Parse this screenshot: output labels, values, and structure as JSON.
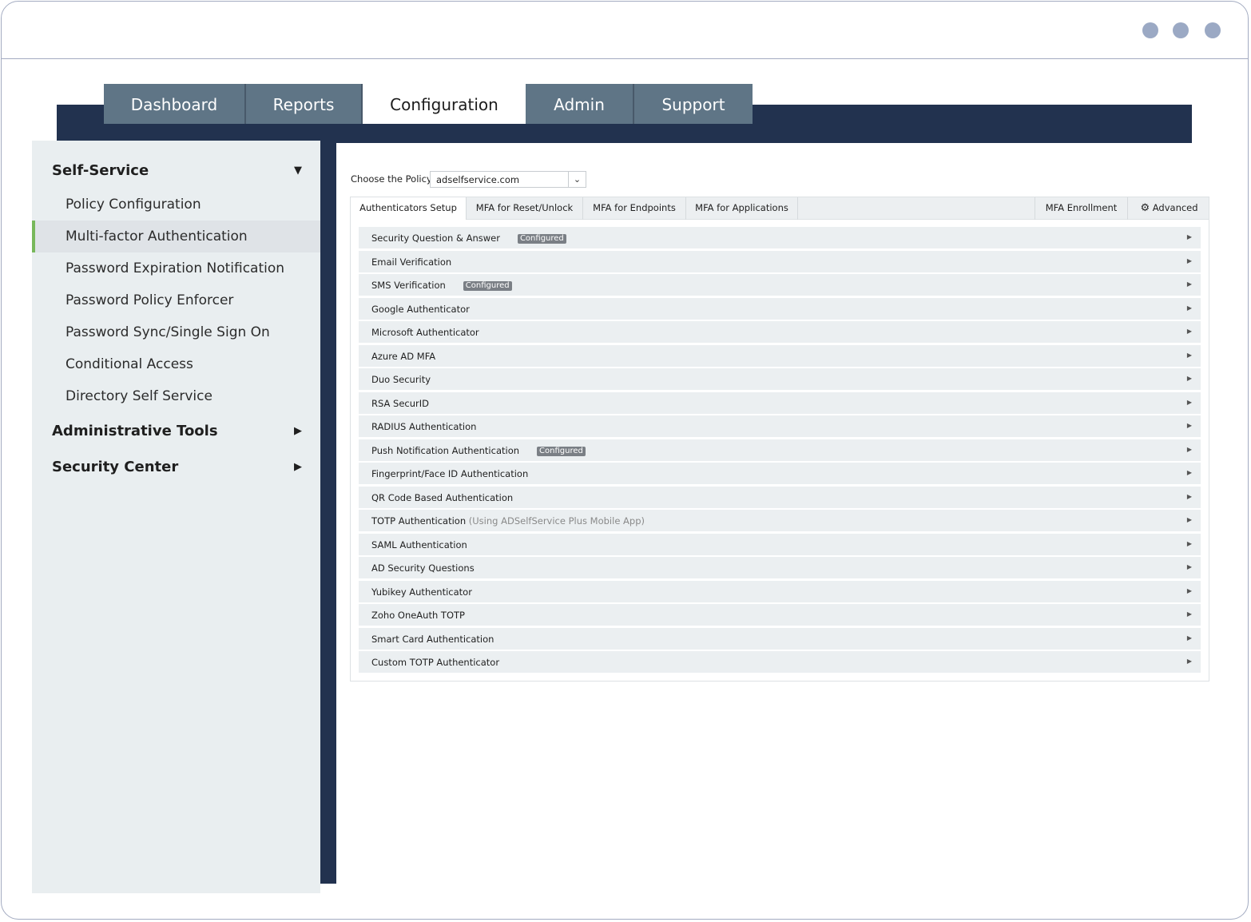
{
  "nav_tabs": [
    {
      "label": "Dashboard"
    },
    {
      "label": "Reports"
    },
    {
      "label": "Configuration"
    },
    {
      "label": "Admin"
    },
    {
      "label": "Support"
    }
  ],
  "sidebar": {
    "self_service": {
      "title": "Self-Service",
      "items": [
        {
          "label": "Policy Configuration"
        },
        {
          "label": "Multi-factor Authentication"
        },
        {
          "label": "Password Expiration Notification"
        },
        {
          "label": "Password Policy Enforcer"
        },
        {
          "label": "Password Sync/Single Sign On"
        },
        {
          "label": "Conditional Access"
        },
        {
          "label": "Directory Self Service"
        }
      ]
    },
    "administrative_tools": {
      "title": "Administrative Tools"
    },
    "security_center": {
      "title": "Security Center"
    }
  },
  "policy": {
    "label": "Choose the Policy",
    "value": "adselfservice.com"
  },
  "sub_tabs": {
    "authenticators_setup": "Authenticators Setup",
    "mfa_reset_unlock": "MFA for Reset/Unlock",
    "mfa_endpoints": "MFA for Endpoints",
    "mfa_applications": "MFA for Applications",
    "mfa_enrollment": "MFA Enrollment",
    "advanced": "Advanced"
  },
  "badge_text": "Configured",
  "authenticators": [
    {
      "label": "Security Question & Answer",
      "badge": "Configured"
    },
    {
      "label": "Email Verification"
    },
    {
      "label": "SMS Verification",
      "badge": "Configured"
    },
    {
      "label": "Google Authenticator"
    },
    {
      "label": "Microsoft Authenticator"
    },
    {
      "label": "Azure AD MFA"
    },
    {
      "label": "Duo Security"
    },
    {
      "label": "RSA SecurID"
    },
    {
      "label": "RADIUS Authentication"
    },
    {
      "label": "Push Notification Authentication",
      "badge": "Configured"
    },
    {
      "label": "Fingerprint/Face ID Authentication"
    },
    {
      "label": "QR Code Based Authentication"
    },
    {
      "label": "TOTP Authentication",
      "note": "(Using ADSelfService Plus Mobile App)"
    },
    {
      "label": "SAML Authentication"
    },
    {
      "label": "AD Security Questions"
    },
    {
      "label": "Yubikey Authenticator"
    },
    {
      "label": "Zoho OneAuth TOTP"
    },
    {
      "label": "Smart Card Authentication"
    },
    {
      "label": "Custom TOTP Authenticator"
    }
  ]
}
